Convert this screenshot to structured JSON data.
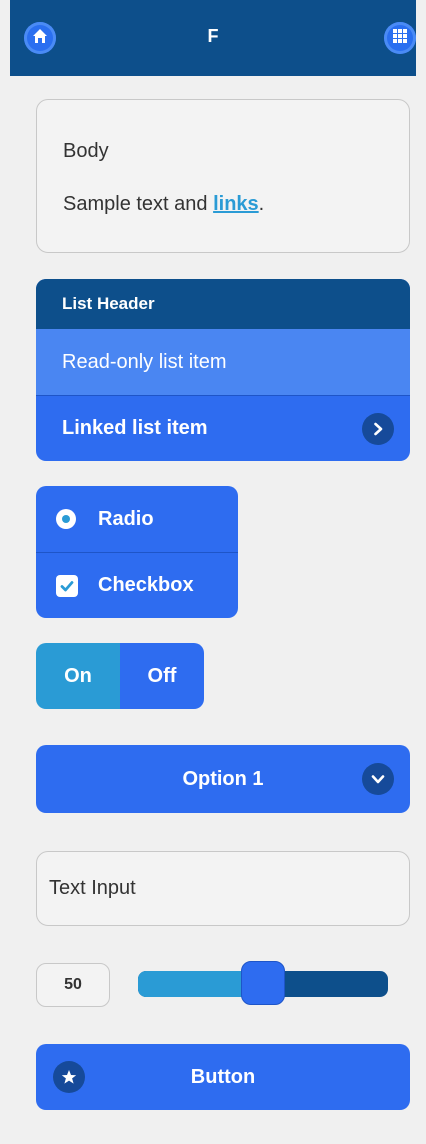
{
  "header": {
    "title": "F",
    "left_icon": "home-icon",
    "right_icon": "grid-icon"
  },
  "body_card": {
    "title": "Body",
    "text_prefix": "Sample text and ",
    "link_text": "links",
    "text_suffix": "."
  },
  "list": {
    "header": "List Header",
    "items": [
      {
        "label": "Read-only list item",
        "type": "read-only"
      },
      {
        "label": "Linked list item",
        "type": "link",
        "icon": "chevron-right-icon"
      }
    ]
  },
  "controls": {
    "radio_label": "Radio",
    "checkbox_label": "Checkbox",
    "radio_selected": true,
    "checkbox_checked": true
  },
  "toggle": {
    "on_label": "On",
    "off_label": "Off",
    "active": "On"
  },
  "select": {
    "selected": "Option 1",
    "icon": "chevron-down-icon"
  },
  "text_input": {
    "placeholder": "Text Input",
    "value": ""
  },
  "slider": {
    "value": "50",
    "min": 0,
    "max": 100
  },
  "button": {
    "label": "Button",
    "icon": "star-icon"
  },
  "colors": {
    "header_bg": "#0d4f8b",
    "primary": "#2e6cf0",
    "accent": "#2a9bd5",
    "background": "#f0f0f0"
  }
}
